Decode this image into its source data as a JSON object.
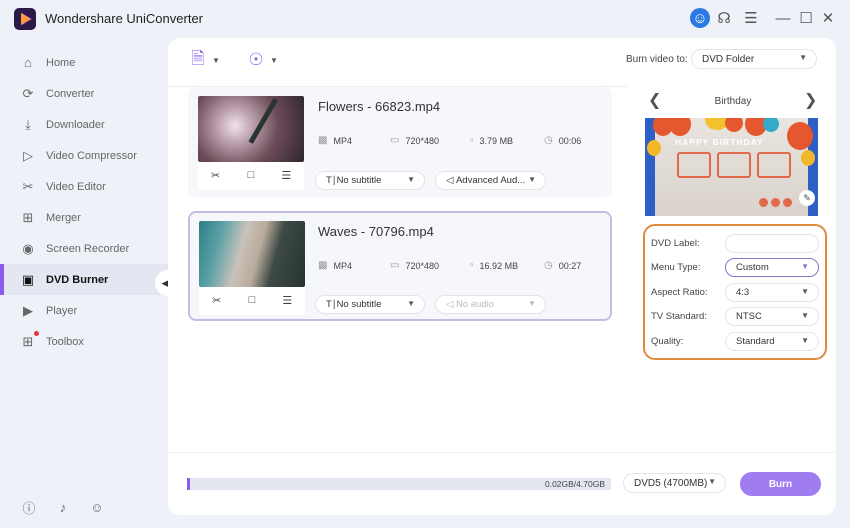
{
  "app": {
    "title": "Wondershare UniConverter"
  },
  "titlebar": {
    "icons": [
      "user-icon",
      "headset-icon",
      "menu-icon",
      "minimize-icon",
      "maximize-icon",
      "close-icon"
    ]
  },
  "sidebar": {
    "items": [
      {
        "label": "Home",
        "icon": "home-icon"
      },
      {
        "label": "Converter",
        "icon": "converter-icon"
      },
      {
        "label": "Downloader",
        "icon": "downloader-icon"
      },
      {
        "label": "Video Compressor",
        "icon": "compressor-icon"
      },
      {
        "label": "Video Editor",
        "icon": "scissors-icon"
      },
      {
        "label": "Merger",
        "icon": "merger-icon"
      },
      {
        "label": "Screen Recorder",
        "icon": "screen-recorder-icon"
      },
      {
        "label": "DVD Burner",
        "icon": "dvd-burner-icon",
        "active": true
      },
      {
        "label": "Player",
        "icon": "player-icon"
      },
      {
        "label": "Toolbox",
        "icon": "toolbox-icon",
        "badge": true
      }
    ],
    "bottom_icons": [
      "help-icon",
      "bell-icon",
      "feedback-icon"
    ]
  },
  "toolbar": {
    "burn_to_label": "Burn video to:",
    "burn_to_value": "DVD Folder"
  },
  "files": [
    {
      "title": "Flowers - 66823.mp4",
      "format": "MP4",
      "resolution": "720*480",
      "size": "3.79 MB",
      "duration": "00:06",
      "subtitle": "No subtitle",
      "audio": "Advanced Aud...",
      "audio_disabled": false,
      "selected": false
    },
    {
      "title": "Waves - 70796.mp4",
      "format": "MP4",
      "resolution": "720*480",
      "size": "16.92 MB",
      "duration": "00:27",
      "subtitle": "No subtitle",
      "audio": "No audio",
      "audio_disabled": true,
      "selected": true
    }
  ],
  "template": {
    "name": "Birthday",
    "preview_heading": "HAPPY BIRTHDAY"
  },
  "settings": {
    "dvd_label": {
      "label": "DVD Label:",
      "value": ""
    },
    "menu_type": {
      "label": "Menu Type:",
      "value": "Custom"
    },
    "aspect_ratio": {
      "label": "Aspect Ratio:",
      "value": "4:3"
    },
    "tv_standard": {
      "label": "TV Standard:",
      "value": "NTSC"
    },
    "quality": {
      "label": "Quality:",
      "value": "Standard"
    }
  },
  "bottom": {
    "usage_text": "0.02GB/4.70GB",
    "usage_fraction": 0.004,
    "disc_type": "DVD5 (4700MB)",
    "burn_label": "Burn"
  },
  "colors": {
    "accent": "#8a5cf0",
    "burn_button": "#9f7cf0",
    "settings_border": "#e08a3c",
    "user_avatar": "#2a7ae2"
  }
}
